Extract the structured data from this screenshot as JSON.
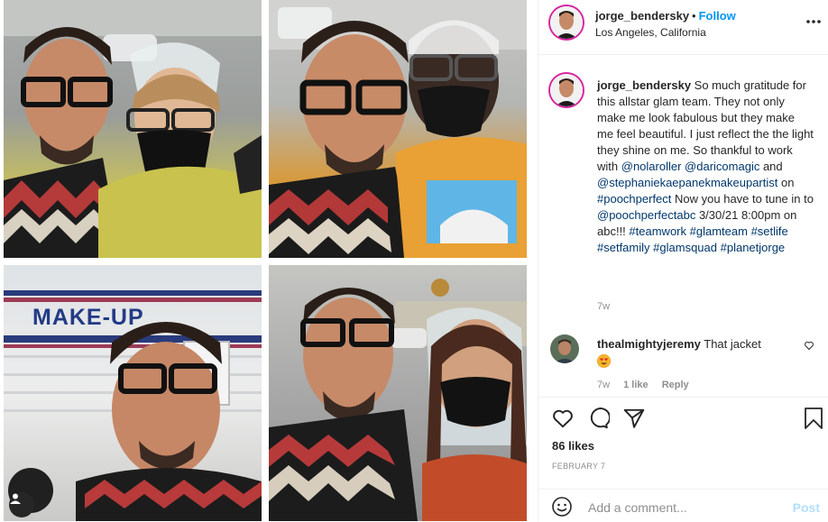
{
  "post": {
    "username": "jorge_bendersky",
    "separator": "•",
    "follow_label": "Follow",
    "location": "Los Angeles, California",
    "more_icon": "more-horizontal-icon",
    "caption": {
      "username": "jorge_bendersky",
      "text_1": "So much gratitude for this allstar glam team. They not only make me look fabulous but they make me feel beautiful. I just reflect the the light they shine on me. So thankful to work with",
      "mention_1": "@nolaroller",
      "mention_2": "@daricomagic",
      "text_and": "and",
      "mention_3": "@stephaniekaepanekmakeupartist",
      "text_on": "on",
      "hashtag_1": "#poochperfect",
      "text_2": "Now you have to tune in to",
      "mention_4": "@poochperfectabc",
      "text_3": "3/30/21 8:00pm on abc!!!",
      "hashtag_2": "#teamwork",
      "hashtag_3": "#glamteam",
      "hashtag_4": "#setlife",
      "hashtag_5": "#setfamily",
      "hashtag_6": "#glamsquad",
      "hashtag_7": "#planetjorge",
      "time": "7w"
    },
    "comment": {
      "username": "thealmightyjeremy",
      "text": "That jacket",
      "time": "7w",
      "likes": "1 like",
      "reply": "Reply"
    },
    "likes": "86 likes",
    "date": "FEBRUARY 7",
    "add_comment_placeholder": "Add a comment...",
    "post_label": "Post"
  },
  "media": {
    "trailer_sign": "MAKE-UP"
  },
  "colors": {
    "link": "#00376b",
    "follow": "#0095f6",
    "muted": "#8e8e8e",
    "story_ring": "#d6249f"
  }
}
